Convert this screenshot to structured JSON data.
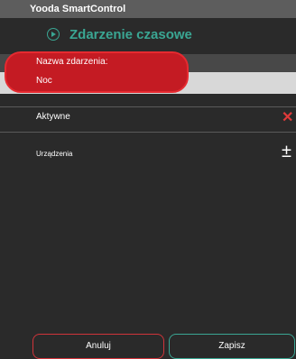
{
  "window": {
    "title": "Yooda SmartControl"
  },
  "header": {
    "title": "Zdarzenie czasowe",
    "icon": "play-circle-icon"
  },
  "form": {
    "name_label": "Nazwa zdarzenia:",
    "name_value": "Noc",
    "active_label": "Aktywne",
    "active_icon": "close-icon",
    "devices_label": "Urządzenia",
    "devices_icon": "plus-minus-icon"
  },
  "footer": {
    "cancel_label": "Anuluj",
    "save_label": "Zapisz"
  },
  "colors": {
    "accent": "#3aa693",
    "danger": "#d0343a",
    "highlight": "#c41b23"
  }
}
